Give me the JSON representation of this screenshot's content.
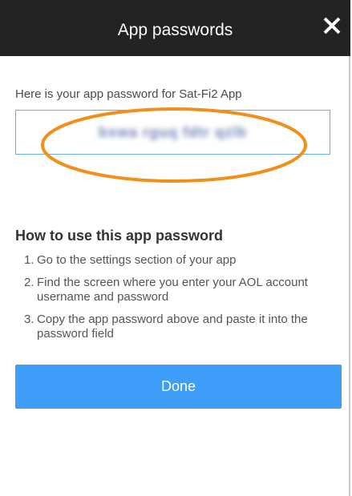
{
  "dialog": {
    "title": "App passwords",
    "close_icon": "close-icon",
    "intro_text": "Here is your app password for Sat-Fi2 App",
    "app_password": "bxwa rguq fdtr qzlb",
    "app_password_obscured": true,
    "highlight_color": "#F0901A"
  },
  "howto": {
    "title": "How to use this app password",
    "steps": [
      {
        "num": "1.",
        "text": "Go to the settings section of your app"
      },
      {
        "num": "2.",
        "text": "Find the screen where you enter your AOL account username and password"
      },
      {
        "num": "3.",
        "text": "Copy the app password above and paste it into the password field"
      }
    ]
  },
  "actions": {
    "done_label": "Done"
  },
  "colors": {
    "header_bg": "#232323",
    "button_bg": "#3D9DF8",
    "input_border": "#6AAEF0"
  }
}
